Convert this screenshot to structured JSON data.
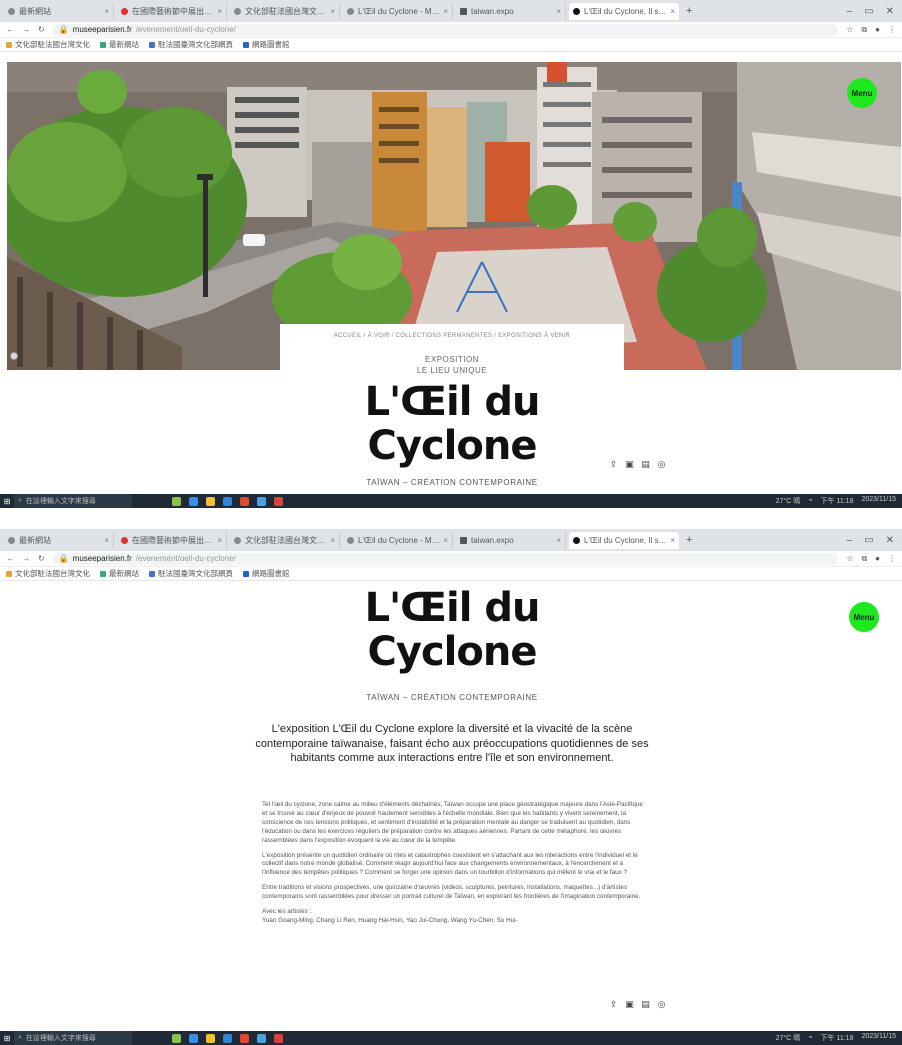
{
  "browser": {
    "tabs": [
      {
        "label": "最新網站",
        "active": false
      },
      {
        "label": "在國際藝術節中展出的...",
        "active": false
      },
      {
        "label": "文化部駐法國台灣文化...",
        "active": false
      },
      {
        "label": "L'Œil du Cyclone - Musée...",
        "active": false
      },
      {
        "label": "taiwan.expo",
        "active": false
      },
      {
        "label": "L'Œil du Cyclone, Il se cyclone...",
        "active": true
      }
    ],
    "url_host": "museeparisien.fr",
    "url_path": "/evenement/oeil-du-cyclone/",
    "bookmarks": [
      "文化部駐法國台灣文化",
      "最新網站",
      "駐法國臺灣文化部網頁",
      "網路圖書館"
    ]
  },
  "hero": {
    "menu_label": "Menu",
    "breadcrumb": "ACCUEIL / À VOIR / COLLECTIONS PERMANENTES / EXPOSITIONS À VENIR",
    "kicker_line1": "EXPOSITION",
    "kicker_line2": "LE LIEU UNIQUE",
    "title_line1": "L'Œil du",
    "title_line2": "Cyclone",
    "subtitle": "TAÏWAN – CRÉATION CONTEMPORAINE"
  },
  "share_icons": [
    "share-icon",
    "facebook-icon",
    "twitter-icon",
    "linkedin-icon"
  ],
  "taskbar": {
    "search_placeholder": "在這裡輸入文字來搜尋",
    "tray_text": "27°C 晴",
    "time": "下午 11:18",
    "date": "2023/11/15"
  },
  "article": {
    "title_line1": "L'Œil du",
    "title_line2": "Cyclone",
    "subtitle": "TAÏWAN – CRÉATION CONTEMPORAINE",
    "lead": "L'exposition L'Œil du Cyclone explore la diversité et la vivacité de la scène contemporaine taïwanaise, faisant écho aux préoccupations quotidiennes de ses habitants comme aux interactions entre l'île et son environnement.",
    "paragraphs": [
      "Tel l'œil du cyclone, zone calme au milieu d'éléments déchaînés, Taïwan occupe une place géostratégique majeure dans l'Asie-Pacifique et se trouve au cœur d'enjeux de pouvoir hautement sensibles à l'échelle mondiale. Bien que les habitants y vivent sereinement, la conscience de ces tensions politiques, et sentiment d'instabilité et la préparation mentale au danger se traduisent au quotidien, dans l'éducation ou dans les exercices réguliers de préparation contre les attaques aériennes. Partant de cette métaphore, les œuvres rassemblées dans l'exposition évoquent la vie au cœur de la tempête.",
      "L'exposition présente un quotidien ordinaire où rites et catastrophes coexistent en s'attachant aux les interactions entre l'individuel et le collectif dans notre monde globalisé. Comment réagir aujourd'hui face aux changements environnementaux, à l'encerclement et à l'influence des tempêtes politiques ? Comment se forger une opinion dans un tourbillon d'informations qui mêlent le vrai et le faux ?",
      "Entre traditions et visions prospectives, une quinzaine d'œuvres (vidéos, sculptures, peintures, installations, maquettes...) d'artistes contemporains sont rassemblées pour dresser un portrait culturel de Taïwan, en explorant les frontières de l'imagination contemporaine."
    ],
    "artists_label": "Avec les artistes :",
    "artists": "Yuan Goang-Ming, Chang Li Ren, Huang Hai-Hsin, Yao Jui-Chung, Wang Yu-Chen, Su Hui-"
  },
  "colors": {
    "menu_green": "#1ee81e",
    "taskbar": "#1f2a36"
  }
}
